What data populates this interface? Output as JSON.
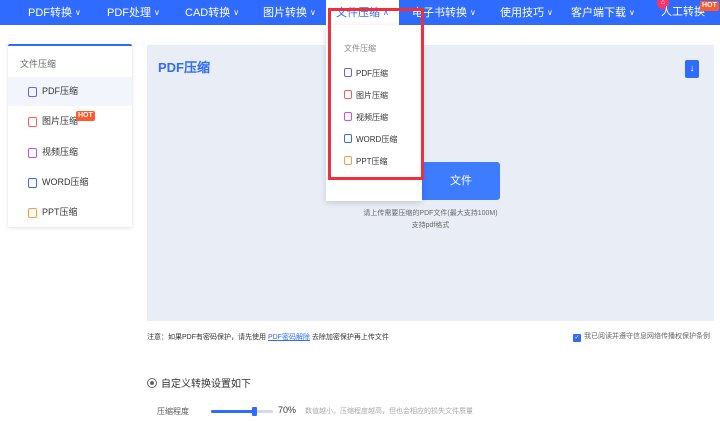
{
  "nav": {
    "items": [
      {
        "label": "PDF转换"
      },
      {
        "label": "PDF处理"
      },
      {
        "label": "CAD转换"
      },
      {
        "label": "图片转换"
      },
      {
        "label": "文件压缩"
      },
      {
        "label": "电子书转换"
      },
      {
        "label": "使用技巧"
      },
      {
        "label": "客户端下载"
      },
      {
        "label": "人工转换"
      }
    ],
    "hot_badge": "HOT",
    "chevron_down": "∨",
    "chevron_up": "∧"
  },
  "dropdown": {
    "heading": "文件压缩",
    "items": [
      {
        "label": "PDF压缩"
      },
      {
        "label": "图片压缩"
      },
      {
        "label": "视频压缩"
      },
      {
        "label": "WORD压缩"
      },
      {
        "label": "PPT压缩"
      }
    ]
  },
  "sidebar": {
    "title": "文件压缩",
    "items": [
      {
        "label": "PDF压缩"
      },
      {
        "label": "图片压缩"
      },
      {
        "label": "视频压缩"
      },
      {
        "label": "WORD压缩"
      },
      {
        "label": "PPT压缩"
      }
    ],
    "hot_badge": "HOT"
  },
  "upload": {
    "title": "PDF压缩",
    "button_label": "文件",
    "hint_line1": "请上传需要压缩的PDF文件(最大支持100M)",
    "hint_line2": "支持pdf格式"
  },
  "note": {
    "prefix": "注意：如果PDF有密码保护，请先使用",
    "link": "PDF密码解除",
    "suffix": "去除加密保护再上传文件",
    "agree": "我已阅读并遵守信息网络传播权保护条例"
  },
  "settings": {
    "title": "自定义转换设置如下",
    "slider_label": "压缩程度",
    "value_text": "70%",
    "value_fraction": 0.7,
    "description": "数值越小，压缩程度越高，但也会相应的损失文件质量"
  },
  "colors": {
    "accent": "#2f6bff",
    "highlight_frame": "#ee2f3c",
    "hot": "#ff5a2d"
  }
}
